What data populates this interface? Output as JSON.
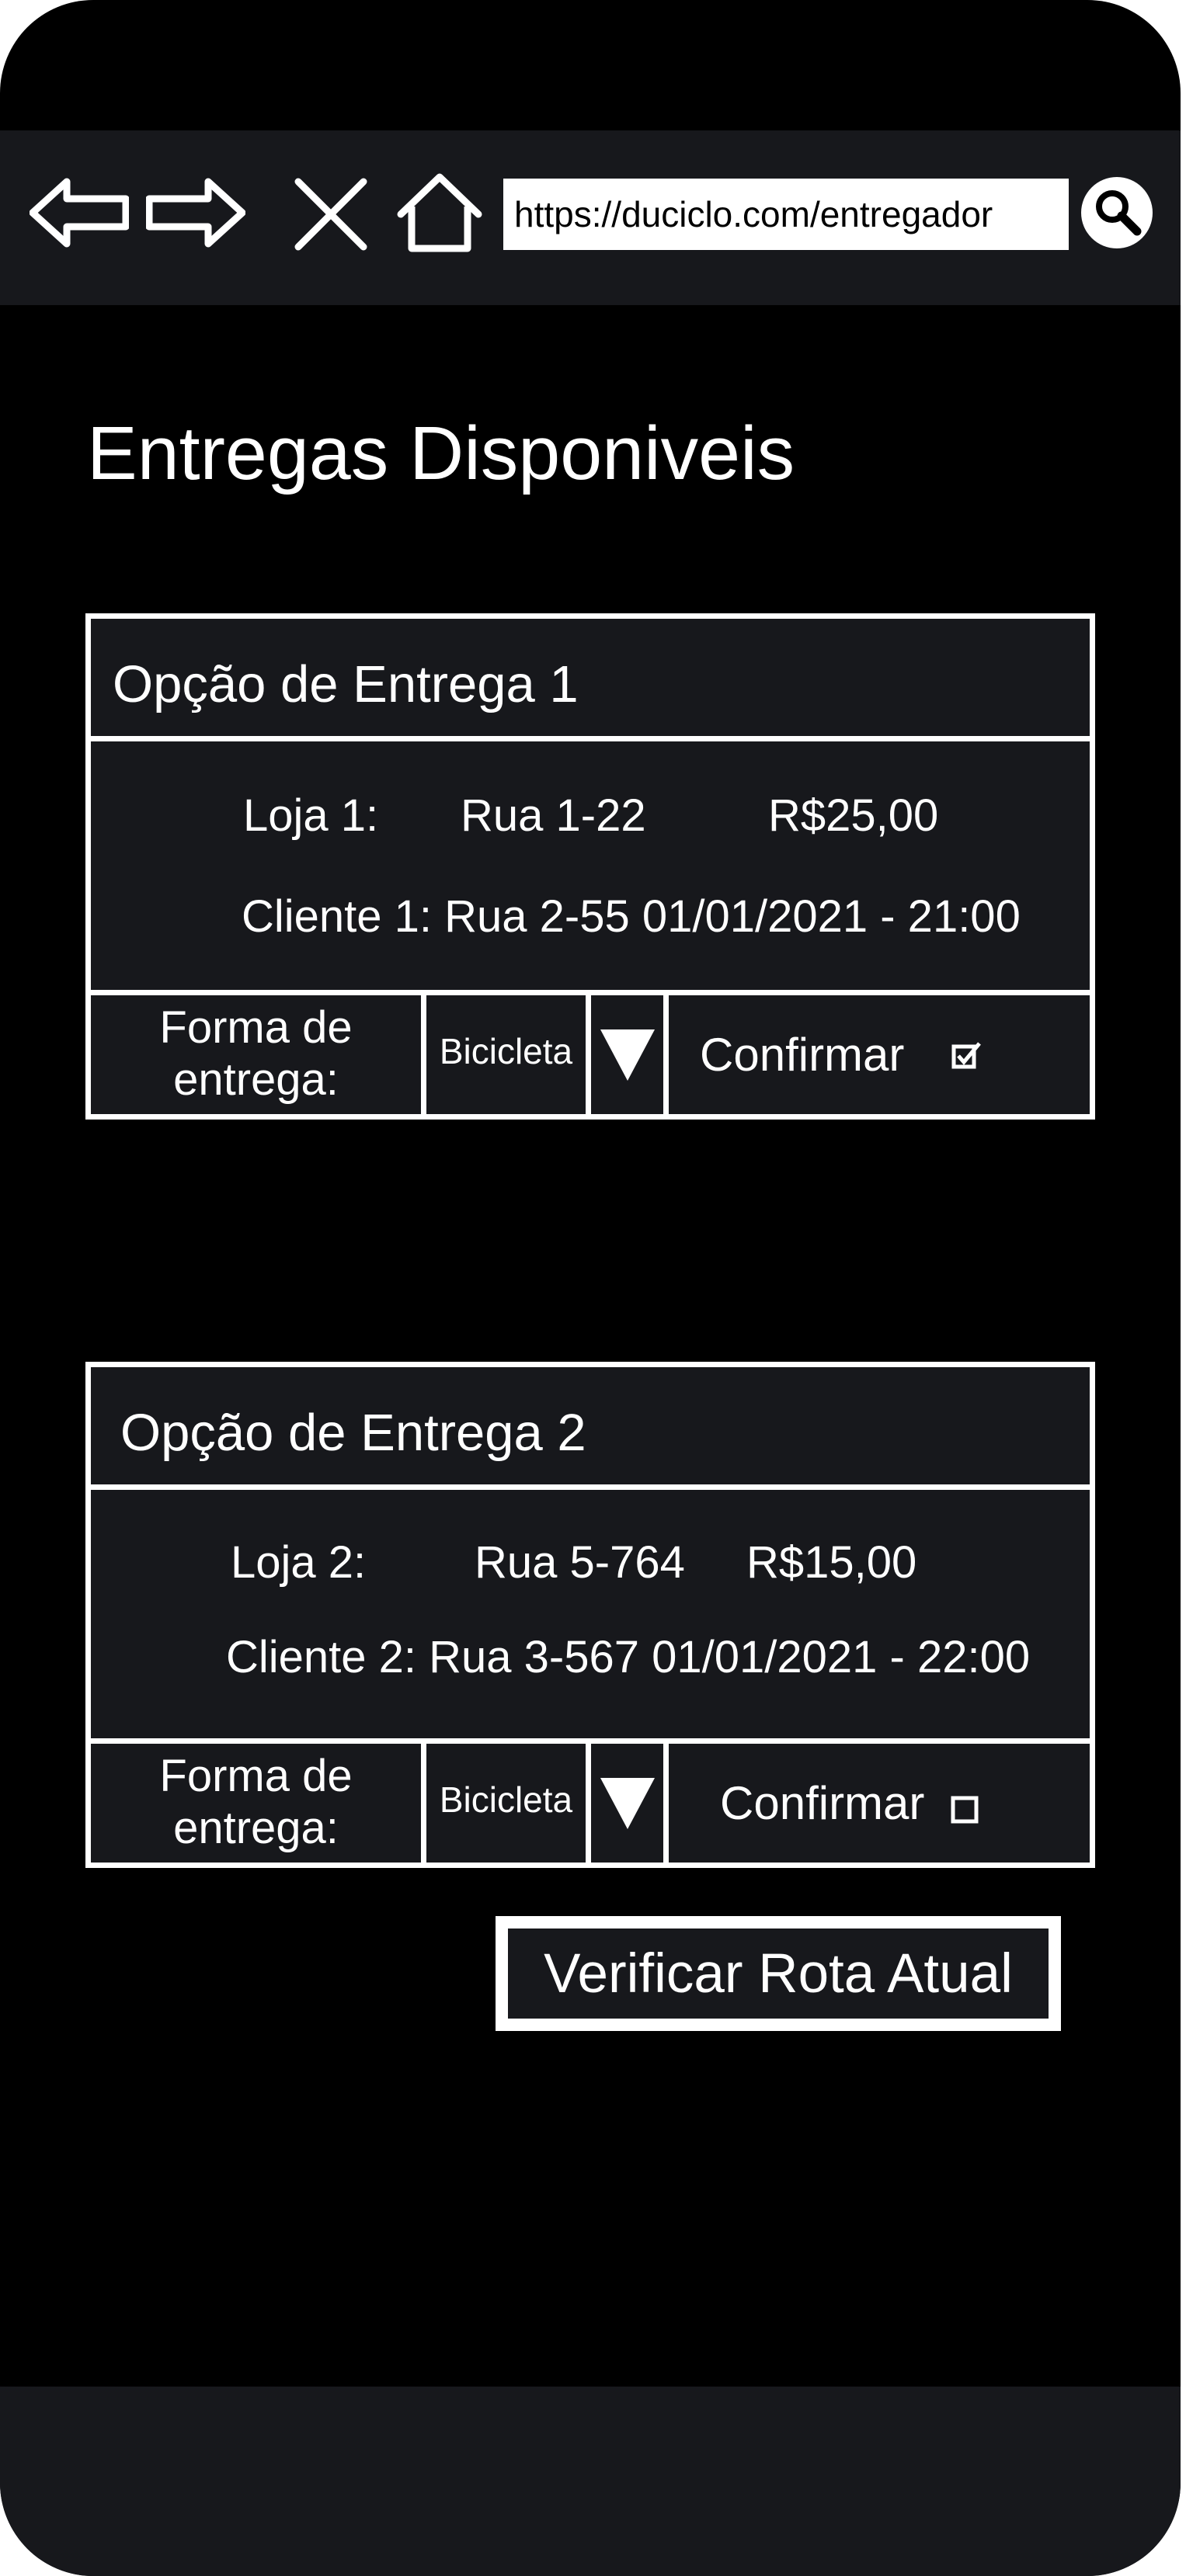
{
  "browser": {
    "url": "https://duciclo.com/entregador"
  },
  "page": {
    "title": "Entregas Disponiveis"
  },
  "deliveries": [
    {
      "title": "Opção de Entrega 1",
      "store_label": "Loja 1:",
      "store_address": "Rua 1-22",
      "price": "R$25,00",
      "client_line": "Cliente 1: Rua 2-55 01/01/2021 - 21:00",
      "delivery_method_label": "Forma de entrega:",
      "delivery_method_value": "Bicicleta",
      "confirm_label": "Confirmar",
      "confirmed": true
    },
    {
      "title": "Opção de Entrega 2",
      "store_label": "Loja 2:",
      "store_address": "Rua 5-764",
      "price": "R$15,00",
      "client_line": "Cliente 2: Rua 3-567 01/01/2021 - 22:00",
      "delivery_method_label": "Forma de entrega:",
      "delivery_method_value": "Bicicleta",
      "confirm_label": "Confirmar",
      "confirmed": false
    }
  ],
  "actions": {
    "verify_route_label": "Verificar Rota Atual"
  },
  "icons": {
    "back": "back-arrow-icon",
    "forward": "forward-arrow-icon",
    "close": "close-icon",
    "home": "home-icon",
    "search": "search-icon"
  },
  "colors": {
    "background": "#000000",
    "panel": "#17181c",
    "foreground": "#ffffff"
  }
}
